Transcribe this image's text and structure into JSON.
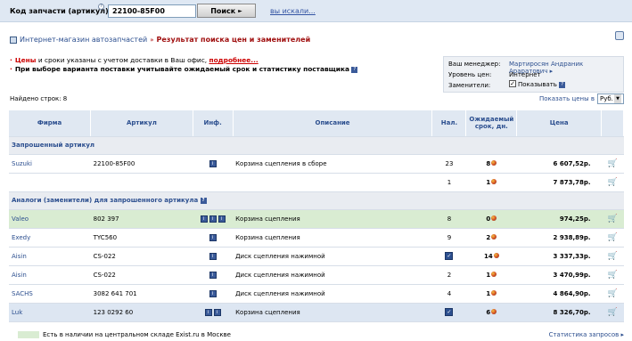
{
  "search": {
    "label": "Код запчасти (артикул):",
    "help_icon": "question-icon",
    "value": "22100-85F00",
    "button_label": "Поиск",
    "history_link": "вы искали..."
  },
  "breadcrumb": {
    "shop": "Интернет-магазин автозапчастей",
    "separator": "»",
    "title": "Результат поиска цен и заменителей"
  },
  "notes": {
    "line1_red": "Цены",
    "line1_text": " и сроки указаны с учетом доставки в Ваш офис, ",
    "line1_link": "подробнее...",
    "line2": "При выборе варианта поставки учитывайте ожидаемый срок и статистику поставщика"
  },
  "manager": {
    "manager_label": "Ваш менеджер:",
    "manager_value": "Мартиросян Андраник Араратович",
    "price_level_label": "Уровень цен:",
    "price_level_value": "Интернет",
    "substitutes_label": "Заменители:",
    "substitutes_value": "Показывать",
    "substitutes_checked": true
  },
  "found_rows": "Найдено строк: 8",
  "currency": {
    "label": "Показать цены в",
    "value": "Руб."
  },
  "table": {
    "headers": {
      "firm": "Фирма",
      "article": "Артикул",
      "info": "Инф.",
      "description": "Описание",
      "availability": "Нал.",
      "expected_term": "Ожидаемый срок, дн.",
      "price": "Цена"
    },
    "section_requested": "Запрошенный артикул",
    "section_analogs": "Аналоги (заменители) для запрошенного артикула",
    "requested_rows": [
      {
        "firm": "Suzuki",
        "article": "22100-85F00",
        "info": 1,
        "description": "Корзина сцепления в сборе",
        "availability": "23",
        "term": "8",
        "price": "6 607,52р.",
        "style": ""
      },
      {
        "firm": "",
        "article": "",
        "info": 0,
        "description": "",
        "availability": "1",
        "term": "1",
        "price": "7 873,78р.",
        "style": ""
      }
    ],
    "analog_rows": [
      {
        "firm": "Valeo",
        "article": "802 397",
        "info": 3,
        "description": "Корзина сцепления",
        "availability": "8",
        "term": "0",
        "price": "974,25р.",
        "style": "green"
      },
      {
        "firm": "Exedy",
        "article": "TYC560",
        "info": 1,
        "description": "Корзина сцепления",
        "availability": "9",
        "term": "2",
        "price": "2 938,89р.",
        "style": ""
      },
      {
        "firm": "Aisin",
        "article": "CS-022",
        "info": 1,
        "description": "Диск сцепления нажимной",
        "availability": "check",
        "term": "14",
        "price": "3 337,33р.",
        "style": ""
      },
      {
        "firm": "Aisin",
        "article": "CS-022",
        "info": 1,
        "description": "Диск сцепления нажимной",
        "availability": "2",
        "term": "1",
        "price": "3 470,99р.",
        "style": ""
      },
      {
        "firm": "SACHS",
        "article": "3082 641 701",
        "info": 1,
        "description": "Диск сцепления нажимной",
        "availability": "4",
        "term": "1",
        "price": "4 864,90р.",
        "style": ""
      },
      {
        "firm": "Luk",
        "article": "123 0292 60",
        "info": 2,
        "description": "Корзина сцепления",
        "availability": "check",
        "term": "6",
        "price": "8 326,70р.",
        "style": "blue"
      }
    ]
  },
  "legend": "Есть в наличии на центральном складе Exist.ru в Москве",
  "stats_link": "Статистика запросов",
  "colors": {
    "brand_blue": "#2c4f8f",
    "header_bg": "#e0e8f2",
    "title_red": "#a01010",
    "in_stock_green": "#d9ecd2"
  }
}
